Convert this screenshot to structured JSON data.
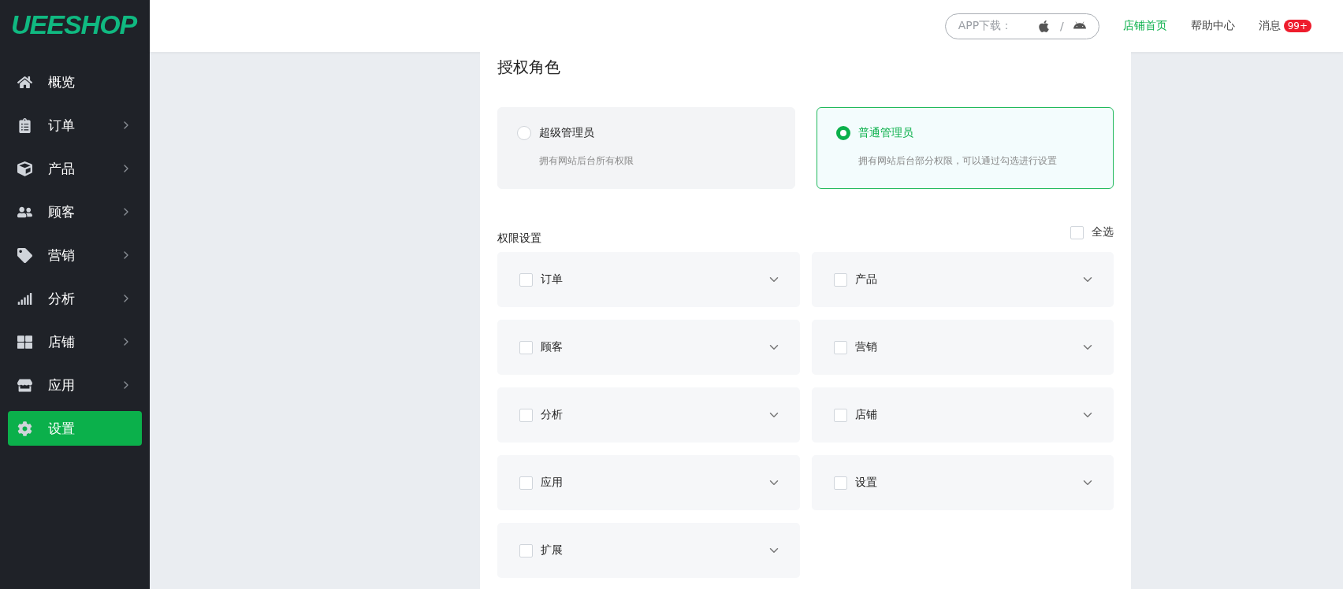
{
  "logo": "UEESHOP",
  "sidebar": {
    "items": [
      {
        "label": "概览",
        "kind": "home",
        "expandable": false,
        "selected": false
      },
      {
        "label": "订单",
        "kind": "orders",
        "expandable": true,
        "selected": false
      },
      {
        "label": "产品",
        "kind": "products",
        "expandable": true,
        "selected": false
      },
      {
        "label": "顾客",
        "kind": "customers",
        "expandable": true,
        "selected": false
      },
      {
        "label": "营销",
        "kind": "marketing",
        "expandable": true,
        "selected": false
      },
      {
        "label": "分析",
        "kind": "analytics",
        "expandable": true,
        "selected": false
      },
      {
        "label": "店铺",
        "kind": "store",
        "expandable": true,
        "selected": false
      },
      {
        "label": "应用",
        "kind": "apps",
        "expandable": true,
        "selected": false
      },
      {
        "label": "设置",
        "kind": "settings",
        "expandable": false,
        "selected": true
      }
    ]
  },
  "header": {
    "app_download": {
      "label": "APP下载：",
      "separator": "/"
    },
    "links": [
      {
        "label": "店铺首页",
        "selected": true
      },
      {
        "label": "帮助中心",
        "selected": false
      },
      {
        "label": "消息",
        "selected": false,
        "badge": "99+"
      }
    ]
  },
  "title": "授权角色",
  "roles": [
    {
      "name": "超级管理员",
      "description": "拥有网站后台所有权限",
      "selected": false
    },
    {
      "name": "普通管理员",
      "description": "拥有网站后台部分权限，可以通过勾选进行设置",
      "selected": true
    }
  ],
  "permissions": {
    "title": "权限设置",
    "select_all": {
      "label": "全选",
      "checked": false
    },
    "items": [
      {
        "label": "订单",
        "checked": false
      },
      {
        "label": "产品",
        "checked": false
      },
      {
        "label": "顾客",
        "checked": false
      },
      {
        "label": "营销",
        "checked": false
      },
      {
        "label": "分析",
        "checked": false
      },
      {
        "label": "店铺",
        "checked": false
      },
      {
        "label": "应用",
        "checked": false
      },
      {
        "label": "设置",
        "checked": false
      },
      {
        "label": "扩展",
        "checked": false
      }
    ]
  }
}
